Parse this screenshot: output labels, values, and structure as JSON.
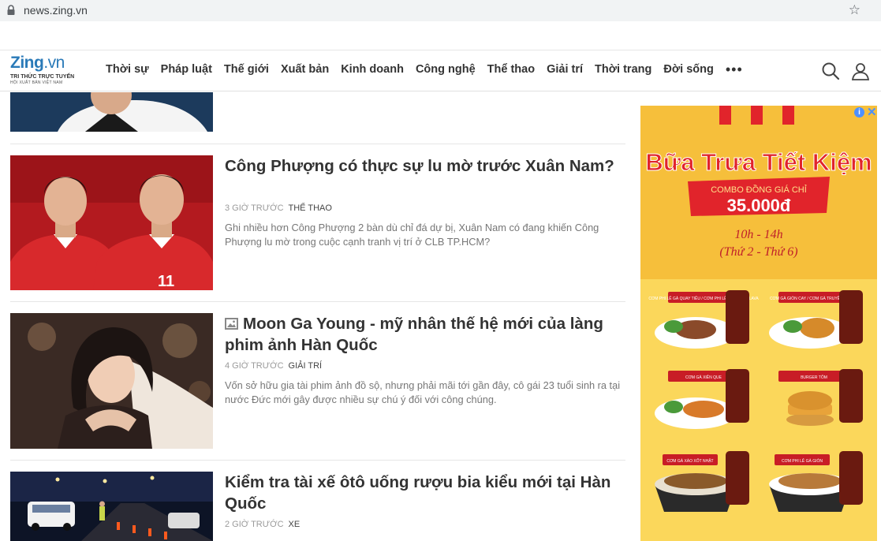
{
  "browser": {
    "url": "news.zing.vn"
  },
  "header": {
    "logo_text": "Zing.vn",
    "logo_tagline": "TRI THỨC TRỰC TUYẾN",
    "logo_subtagline": "HỘI XUẤT BẢN VIỆT NAM",
    "nav": [
      "Thời sự",
      "Pháp luật",
      "Thế giới",
      "Xuất bản",
      "Kinh doanh",
      "Công nghệ",
      "Thể thao",
      "Giải trí",
      "Thời trang",
      "Đời sống"
    ],
    "more_label": "•••"
  },
  "articles": [
    {
      "title": "Công Phượng có thực sự lu mờ trước Xuân Nam?",
      "time": "3 giờ trước",
      "category": "Thể thao",
      "summary": "Ghi nhiều hơn Công Phượng 2 bàn dù chỉ đá dự bị, Xuân Nam có đang khiến Công Phượng lu mờ trong cuộc cạnh tranh vị trí ở CLB TP.HCM?"
    },
    {
      "title": "Moon Ga Young - mỹ nhân thế hệ mới của làng phim ảnh Hàn Quốc",
      "time": "4 giờ trước",
      "category": "Giải trí",
      "summary": "Vốn sở hữu gia tài phim ảnh đồ sộ, nhưng phải mãi tới gần đây, cô gái 23 tuổi sinh ra tại nước Đức mới gây được nhiều sự chú ý đối với công chúng."
    },
    {
      "title": "Kiểm tra tài xế ôtô uống rượu bia kiểu mới tại Hàn Quốc",
      "time": "2 giờ trước",
      "category": "Xe",
      "summary": ""
    }
  ],
  "ad": {
    "headline": "Bữa Trưa Tiết Kiệm",
    "combo": "COMBO ĐỒNG GIÁ CHỈ",
    "price": "35.000đ",
    "hours": "10h - 14h",
    "days": "(Thứ 2 - Thứ 6)",
    "items": [
      "CƠM PHI LÊ GÀ QUAY TIÊU / CƠM PHI LÊ GÀ QUAY FLAVA",
      "CƠM GÀ GIÒN CAY / CƠM GÀ TRUYỀN THỐNG",
      "CƠM GÀ XIÊN QUE",
      "BURGER TÔM",
      "CƠM GÀ XÀO XỐT NHẬT",
      "CƠM PHI LÊ GÀ GIÒN"
    ],
    "info_label": "i",
    "close_label": "✕"
  }
}
